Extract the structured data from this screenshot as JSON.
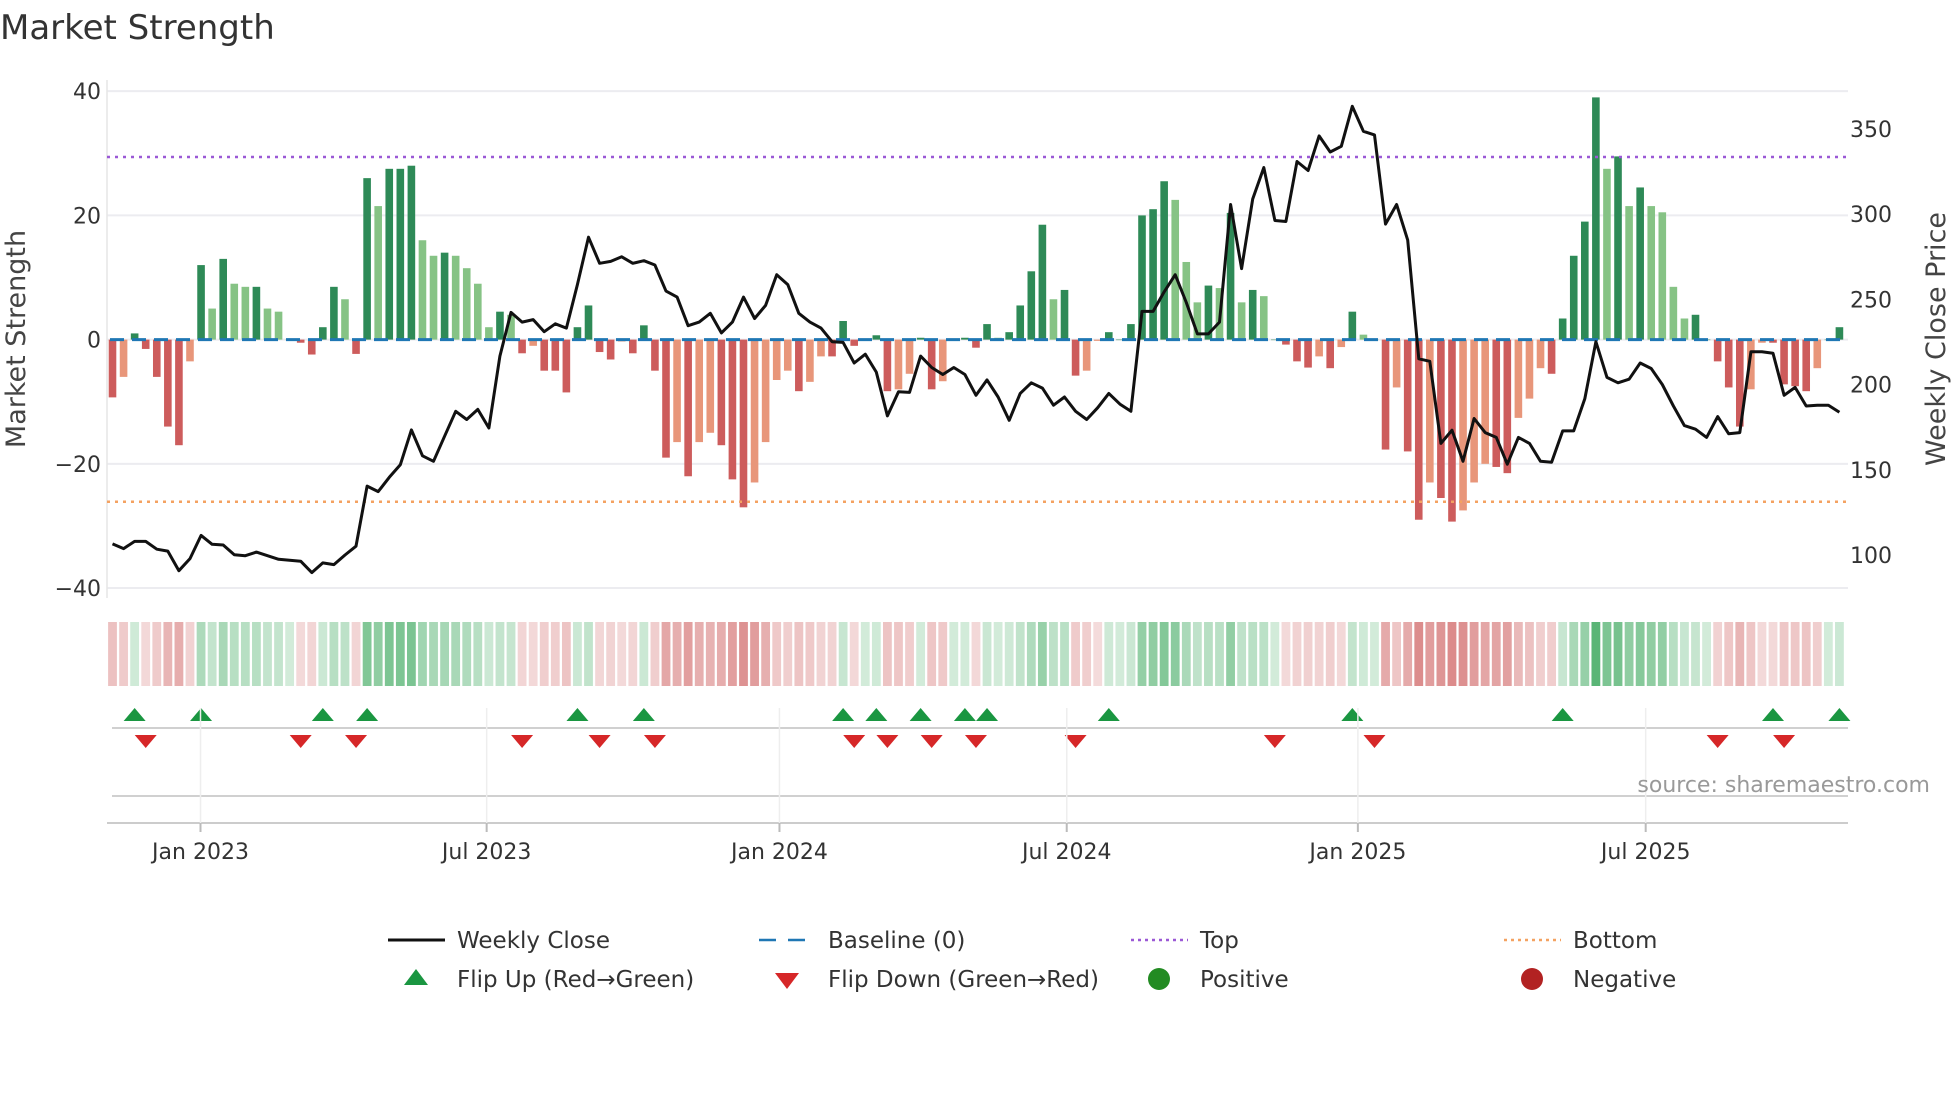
{
  "chart_data": {
    "type": "bar",
    "title": "Market Strength",
    "ylabel": "Market Strength",
    "y2label": "Weekly Close Price",
    "ylim": [
      -41.6,
      41.8
    ],
    "y2lim": [
      74.8,
      378.6
    ],
    "yticks": [
      "40",
      "20",
      "0",
      "−20",
      "−40"
    ],
    "ytick_values": [
      40,
      20,
      0,
      -20,
      -40
    ],
    "y2ticks": [
      "350",
      "300",
      "250",
      "200",
      "150",
      "100"
    ],
    "y2tick_values": [
      350,
      300,
      250,
      200,
      150,
      100
    ],
    "xticks": [
      {
        "label": "Jan 2023",
        "week": 7.95
      },
      {
        "label": "Jul 2023",
        "week": 33.8
      },
      {
        "label": "Jan 2024",
        "week": 60.25
      },
      {
        "label": "Jul 2024",
        "week": 86.2
      },
      {
        "label": "Jan 2025",
        "week": 112.5
      },
      {
        "label": "Jul 2025",
        "week": 138.5
      }
    ],
    "top_level": 29.4,
    "bottom_level": -26.1,
    "baseline": 0,
    "strength": [
      -9.3,
      -6,
      1,
      -1.5,
      -6,
      -14,
      -17,
      -3.5,
      12,
      5,
      13,
      9,
      8.5,
      8.5,
      5,
      4.5,
      0,
      -0.5,
      -2.4,
      2,
      8.5,
      6.5,
      -2.3,
      26,
      21.5,
      27.5,
      27.5,
      28,
      16,
      13.5,
      14,
      13.5,
      11.5,
      9,
      2,
      4.5,
      4,
      -2.2,
      -1,
      -5,
      -5,
      -8.5,
      2,
      5.5,
      -2,
      -3.2,
      -0.3,
      -2.2,
      2.3,
      -5,
      -19,
      -16.5,
      -22,
      -16.5,
      -15,
      -17,
      -22.5,
      -27,
      -23,
      -16.5,
      -6.5,
      -5,
      -8.3,
      -6.8,
      -2.7,
      -2.7,
      3,
      -1,
      0,
      0.7,
      -8.3,
      -8,
      -5.5,
      0.3,
      -8,
      -6.7,
      0,
      0.3,
      -1.3,
      2.5,
      0.3,
      1.2,
      5.5,
      11,
      18.5,
      6.5,
      8,
      -5.8,
      -5,
      -0.2,
      1.2,
      0,
      2.5,
      20,
      21,
      25.5,
      22.5,
      12.5,
      6,
      8.7,
      8.3,
      20.4,
      6,
      8,
      7,
      0,
      -0.8,
      -3.5,
      -4.5,
      -2.7,
      -4.6,
      -1.2,
      4.5,
      0.8,
      0,
      -17.7,
      -7.7,
      -18,
      -29,
      -23,
      -25.5,
      -29.3,
      -27.5,
      -23,
      -20,
      -20.5,
      -21.5,
      -12.6,
      -9.5,
      -4.6,
      -5.5,
      3.4,
      13.5,
      19,
      39,
      27.5,
      29.5,
      21.5,
      24.5,
      21.5,
      20.5,
      8.5,
      3.4,
      4,
      0,
      -3.5,
      -7.7,
      -14,
      -8,
      -0.5,
      -0.5,
      -7.2,
      -7.5,
      -8.3,
      -4.6,
      0,
      2
    ],
    "weekly_close": [
      106.5,
      103.8,
      108,
      108,
      103.4,
      102.3,
      90.8,
      97.9,
      111.5,
      106.3,
      105.9,
      100.2,
      99.6,
      101.7,
      99.6,
      97.5,
      96.9,
      96.4,
      89.7,
      95.4,
      94.4,
      100,
      105.2,
      140.4,
      137.2,
      145.6,
      152.9,
      173.4,
      158.2,
      155,
      169.7,
      184.3,
      179.5,
      185.4,
      174.5,
      216.7,
      242.3,
      236.6,
      238.1,
      231,
      235.6,
      233.1,
      258.6,
      286.4,
      271.1,
      272.2,
      274.9,
      271.1,
      272.6,
      270.1,
      254.8,
      251.3,
      234.5,
      236.6,
      241.8,
      230.3,
      236.6,
      251.3,
      238.7,
      246.4,
      264.4,
      258.6,
      241.8,
      236.6,
      233.1,
      225.1,
      224.7,
      212.6,
      217.8,
      207.3,
      181.6,
      195.8,
      195.4,
      216.7,
      210,
      205.9,
      210,
      205.9,
      193.7,
      202.7,
      192.7,
      179,
      194.8,
      201,
      197.9,
      187.9,
      192.7,
      184.3,
      179.5,
      186.4,
      194.8,
      188.5,
      184.3,
      242.9,
      242.9,
      254.4,
      264.4,
      248.1,
      229.7,
      229.7,
      236.6,
      305.6,
      268,
      308.8,
      327.2,
      296.2,
      295.6,
      330.8,
      325.5,
      345.8,
      336.4,
      339.7,
      363.2,
      348.5,
      346.4,
      294.1,
      305.6,
      284.7,
      215.1,
      213.6,
      165.5,
      173.2,
      155,
      180.1,
      171.8,
      169,
      153.3,
      169,
      165.5,
      155,
      154.4,
      172.8,
      172.8,
      191.6,
      225.1,
      204.2,
      201,
      203.1,
      212.6,
      209.4,
      200,
      187.4,
      175.9,
      173.8,
      169,
      181.2,
      171.1,
      171.8,
      219.2,
      219.2,
      218.4,
      193.7,
      198.3,
      187.4,
      187.9,
      187.9,
      183.7
    ],
    "flip_up_weeks": [
      2,
      8,
      19,
      23,
      42,
      48,
      66,
      69,
      73,
      77,
      79,
      90,
      112,
      131,
      150,
      156
    ],
    "flip_down_weeks": [
      3,
      17,
      22,
      37,
      44,
      49,
      67,
      70,
      74,
      78,
      87,
      105,
      114,
      145,
      151
    ],
    "legend": {
      "placement": "bottom",
      "items": [
        {
          "key": "line",
          "label": "Weekly Close"
        },
        {
          "key": "baseline",
          "label": "Baseline (0)"
        },
        {
          "key": "top",
          "label": "Top"
        },
        {
          "key": "bottom",
          "label": "Bottom"
        },
        {
          "key": "up",
          "label": "Flip Up (Red→Green)"
        },
        {
          "key": "down",
          "label": "Flip Down (Green→Red)"
        },
        {
          "key": "pos",
          "label": "Positive"
        },
        {
          "key": "neg",
          "label": "Negative"
        }
      ]
    },
    "source": "source: sharemaestro.com"
  },
  "colors": {
    "dark_green": "#2e8a57",
    "light_green": "#86c385",
    "red": "#cd5c5c",
    "salmon": "#e8967a",
    "baseline": "#1f77b4",
    "top": "#9b59d6",
    "bottom": "#f4a261",
    "up_marker": "#1a9641",
    "down_marker": "#d62728",
    "positive": "#228b22",
    "negative": "#b22222"
  }
}
